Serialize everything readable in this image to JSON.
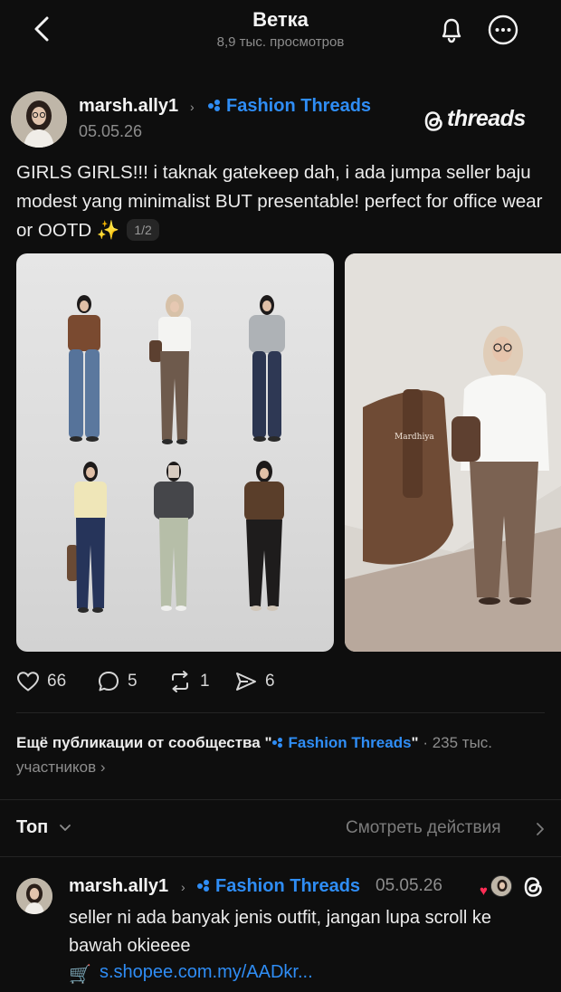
{
  "header": {
    "title": "Ветка",
    "subtitle": "8,9 тыс. просмотров",
    "icons": [
      "back-arrow-icon",
      "bell-icon",
      "more-options-icon"
    ]
  },
  "post": {
    "username": "marsh.ally1",
    "community": "Fashion Threads",
    "date": "05.05.26",
    "brand": "threads",
    "text": "GIRLS GIRLS!!! i taknak gatekeep dah, i ada jumpa seller baju modest yang minimalist BUT presentable! perfect for office wear or OOTD ✨",
    "page_indicator": "1/2",
    "image2_label": "Mardhiya",
    "actions": {
      "likes": "66",
      "replies": "5",
      "reposts": "1",
      "shares": "6"
    }
  },
  "community_more": {
    "prefix": "Ещё публикации от сообщества \"",
    "community": "Fashion Threads",
    "suffix": "\"",
    "members": " · 235 тыс. участников"
  },
  "sort": {
    "label": "Топ",
    "view_actions": "Смотреть действия"
  },
  "reply": {
    "username": "marsh.ally1",
    "community": "Fashion Threads",
    "date": "05.05.26",
    "text": "seller ni ada banyak jenis outfit, jangan lupa scroll ke bawah okieeee",
    "link": "s.shopee.com.my/AADkr..."
  },
  "colors": {
    "background": "#0e0e0e",
    "accent": "#2f8df5",
    "muted": "#8d8d8d",
    "like_red": "#ff2d55"
  }
}
